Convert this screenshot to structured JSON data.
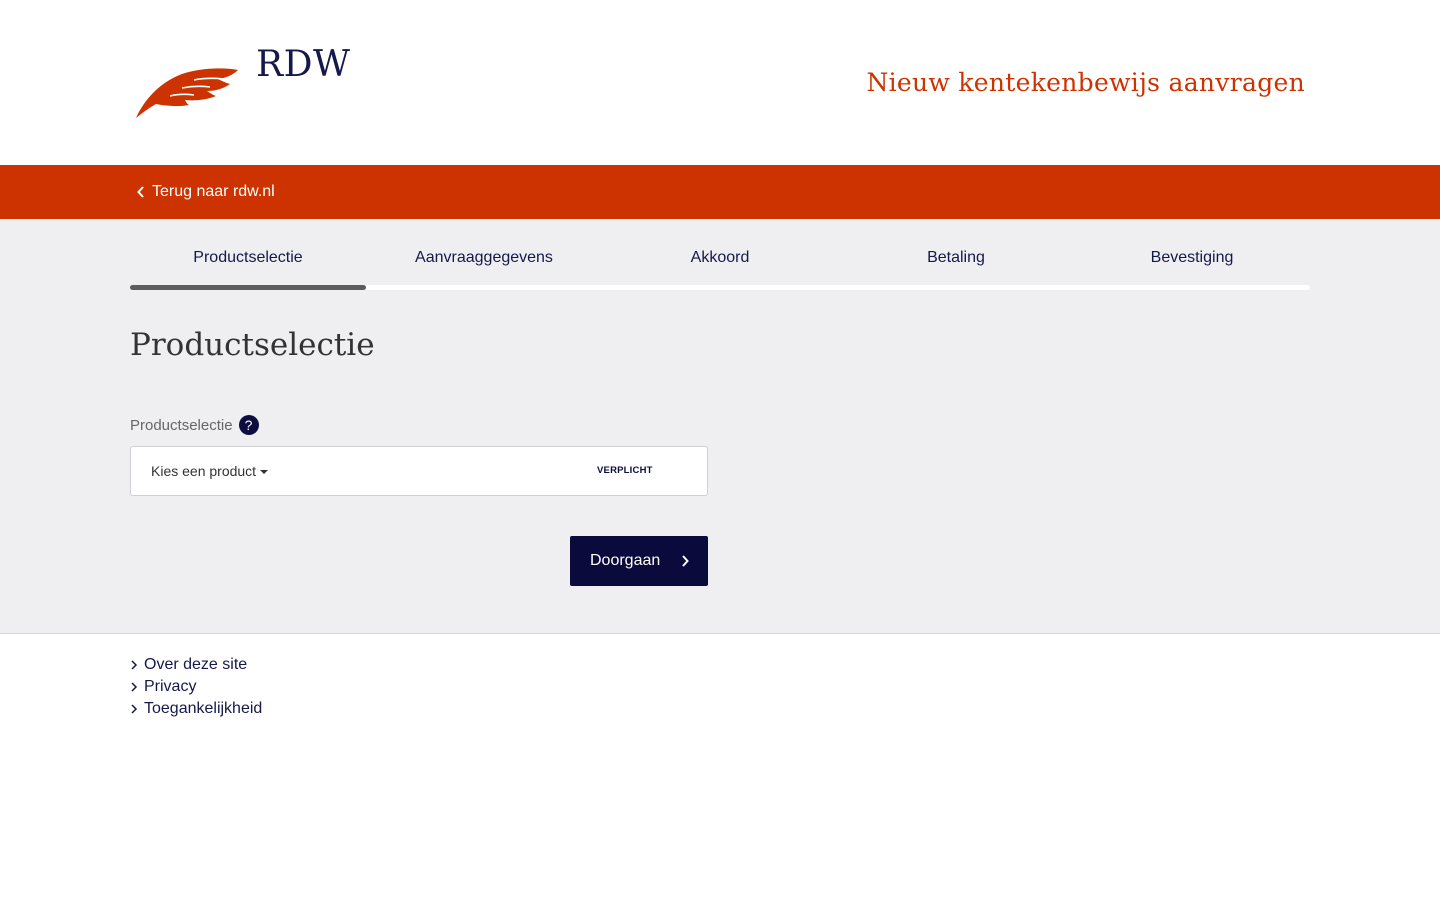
{
  "brand": {
    "name": "RDW",
    "logo_color": "#cc3300",
    "name_color": "#15194a"
  },
  "header": {
    "title": "Nieuw kentekenbewijs aanvragen"
  },
  "topbar": {
    "back_label": "Terug naar rdw.nl",
    "color": "#cc3300"
  },
  "steps": {
    "items": [
      {
        "label": "Productselectie",
        "active": true
      },
      {
        "label": "Aanvraaggegevens",
        "active": false
      },
      {
        "label": "Akkoord",
        "active": false
      },
      {
        "label": "Betaling",
        "active": false
      },
      {
        "label": "Bevestiging",
        "active": false
      }
    ],
    "progress_fraction": 0.2
  },
  "main": {
    "page_title": "Productselectie",
    "field_label": "Productselectie",
    "help_icon": "?",
    "select_value": "Kies een product",
    "required_tag": "VERPLICHT",
    "continue_label": "Doorgaan"
  },
  "footer": {
    "links": [
      "Over deze site",
      "Privacy",
      "Toegankelijkheid"
    ]
  }
}
